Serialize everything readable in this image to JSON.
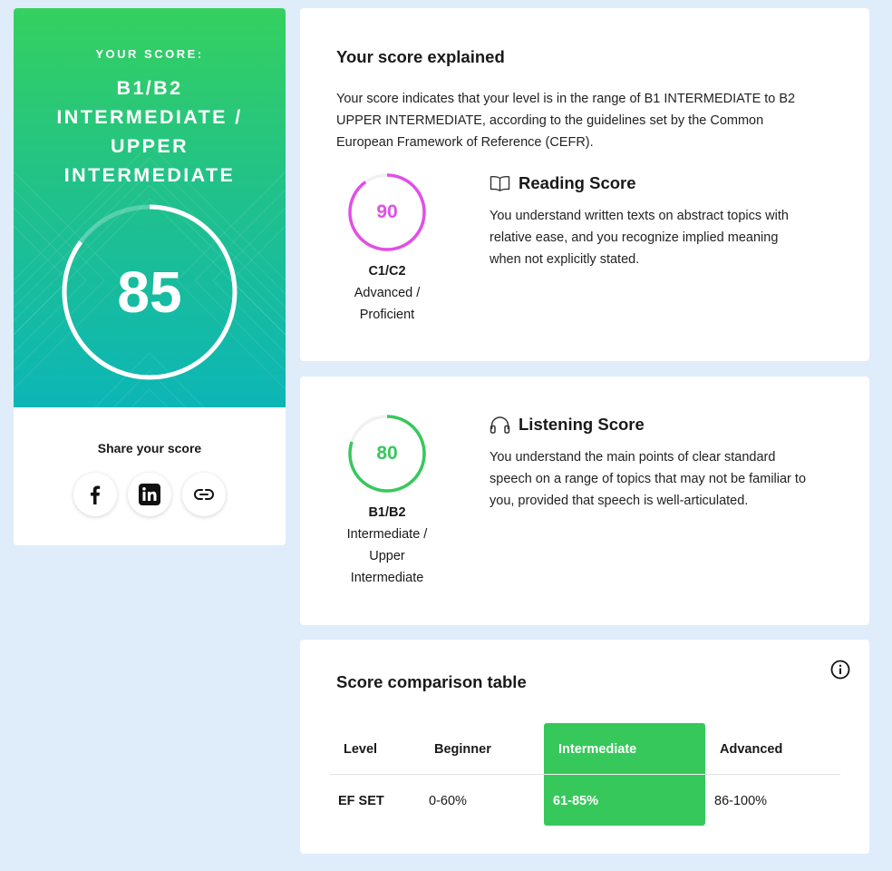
{
  "score_card": {
    "eyebrow": "YOUR SCORE:",
    "level_lines": [
      "B1/B2",
      "INTERMEDIATE /",
      "UPPER",
      "INTERMEDIATE"
    ],
    "score": "85",
    "score_value": 85,
    "share_title": "Share your score",
    "share_buttons": [
      {
        "icon": "facebook-icon"
      },
      {
        "icon": "linkedin-icon"
      },
      {
        "icon": "link-icon"
      }
    ]
  },
  "explained": {
    "title": "Your score explained",
    "paragraph_lines": [
      "Your score indicates that your level is in the range of B1 INTERMEDIATE to B2",
      "UPPER INTERMEDIATE, according to the guidelines set by the Common",
      "European Framework of Reference (CEFR)."
    ]
  },
  "reading": {
    "score": "90",
    "score_value": 90,
    "color": "#e14fe6",
    "level_code": "C1/C2",
    "level_lines": [
      "Advanced /",
      "Proficient"
    ],
    "icon": "book-icon",
    "title": "Reading Score",
    "description_lines": [
      "You understand written texts on abstract topics with",
      "relative ease, and you recognize implied meaning",
      "when not explicitly stated."
    ]
  },
  "listening": {
    "score": "80",
    "score_value": 80,
    "color": "#37c85c",
    "level_code": "B1/B2",
    "level_lines": [
      "Intermediate /",
      "Upper",
      "Intermediate"
    ],
    "icon": "headphones-icon",
    "title": "Listening Score",
    "description_lines": [
      "You understand the main points of clear standard",
      "speech on a range of topics that may not be familiar to",
      "you, provided that speech is well-articulated."
    ]
  },
  "comparison": {
    "title": "Score comparison table",
    "info_icon": "info-icon",
    "headers": [
      "Level",
      "Beginner",
      "Intermediate",
      "Advanced"
    ],
    "row_label": "EF SET",
    "row_values": [
      "0-60%",
      "61-85%",
      "86-100%"
    ],
    "highlight_color": "#37c85c"
  },
  "colors": {
    "page_bg": "#dfecfa",
    "accent_green": "#37c85c",
    "gradient_top": "#35d05f",
    "gradient_bottom": "#0cb6b6"
  }
}
